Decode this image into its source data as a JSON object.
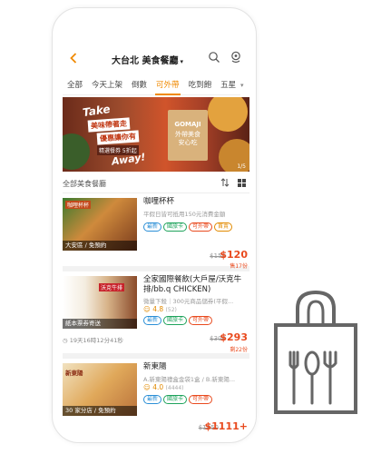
{
  "header": {
    "back_icon": "chevron-left-icon",
    "title": "大台北 美食餐廳",
    "caret": "▾",
    "search_icon": "search-icon",
    "location_icon": "location-pin-icon"
  },
  "tabs": [
    {
      "label": "全部",
      "active": false
    },
    {
      "label": "今天上架",
      "active": false
    },
    {
      "label": "倒數",
      "active": false
    },
    {
      "label": "可外帶",
      "active": true
    },
    {
      "label": "吃到飽",
      "active": false
    },
    {
      "label": "五星",
      "active": false
    }
  ],
  "tabs_more": "▾",
  "banner": {
    "take": "Take",
    "line1": "美味帶著走",
    "line2": "優惠讓你有",
    "offer": "精選餐券 5折起",
    "away": "Away!",
    "bag_brand": "GOMAJI",
    "bag_text": "外帶美食\n安心吃",
    "index": "1/5"
  },
  "list_header": {
    "label": "全部美食餐廳",
    "sort_icon": "sort-icon",
    "grid_icon": "grid-view-icon"
  },
  "cards": [
    {
      "name": "咖哩杯杯",
      "desc": "平假日皆可抵用150元消費金額",
      "tags": [
        {
          "label": "最新",
          "kind": "new"
        },
        {
          "label": "國旅卡",
          "kind": "card"
        },
        {
          "label": "可外帶",
          "kind": "out"
        },
        {
          "label": "首賣",
          "kind": "gift"
        }
      ],
      "image_caption": "大安區 / 免預約",
      "image_sign": "咖哩杯杯",
      "orig_price": "$150",
      "price": "$120",
      "sold": "售17份"
    },
    {
      "name": "全家國際餐飲(大戶屋/沃克牛排/bb.q CHICKEN)",
      "desc": "微量下殺｜300元商品儲券(平假...",
      "rating": "4.8",
      "rating_count": "(52)",
      "tags": [
        {
          "label": "最新",
          "kind": "new"
        },
        {
          "label": "國旅卡",
          "kind": "card"
        },
        {
          "label": "可外帶",
          "kind": "out"
        }
      ],
      "image_caption": "紙本票券寄送",
      "image_sign": "沃克牛排",
      "timer": "19天16時12分41秒",
      "orig_price": "$300",
      "price": "$293",
      "sold": "剩22份"
    },
    {
      "name": "新東陽",
      "desc": "A.新東陽禮盒金袋1盒 / B.新東陽...",
      "rating": "4.0",
      "rating_count": "(4444)",
      "tags": [
        {
          "label": "最新",
          "kind": "new"
        },
        {
          "label": "國旅卡",
          "kind": "card"
        },
        {
          "label": "可外帶",
          "kind": "out"
        }
      ],
      "image_caption": "30 家分店 / 免預約",
      "image_sign": "新東陽",
      "orig_price": "$1950",
      "price": "$1111+"
    }
  ],
  "bag_icon": "shopping-bag-utensils-icon"
}
